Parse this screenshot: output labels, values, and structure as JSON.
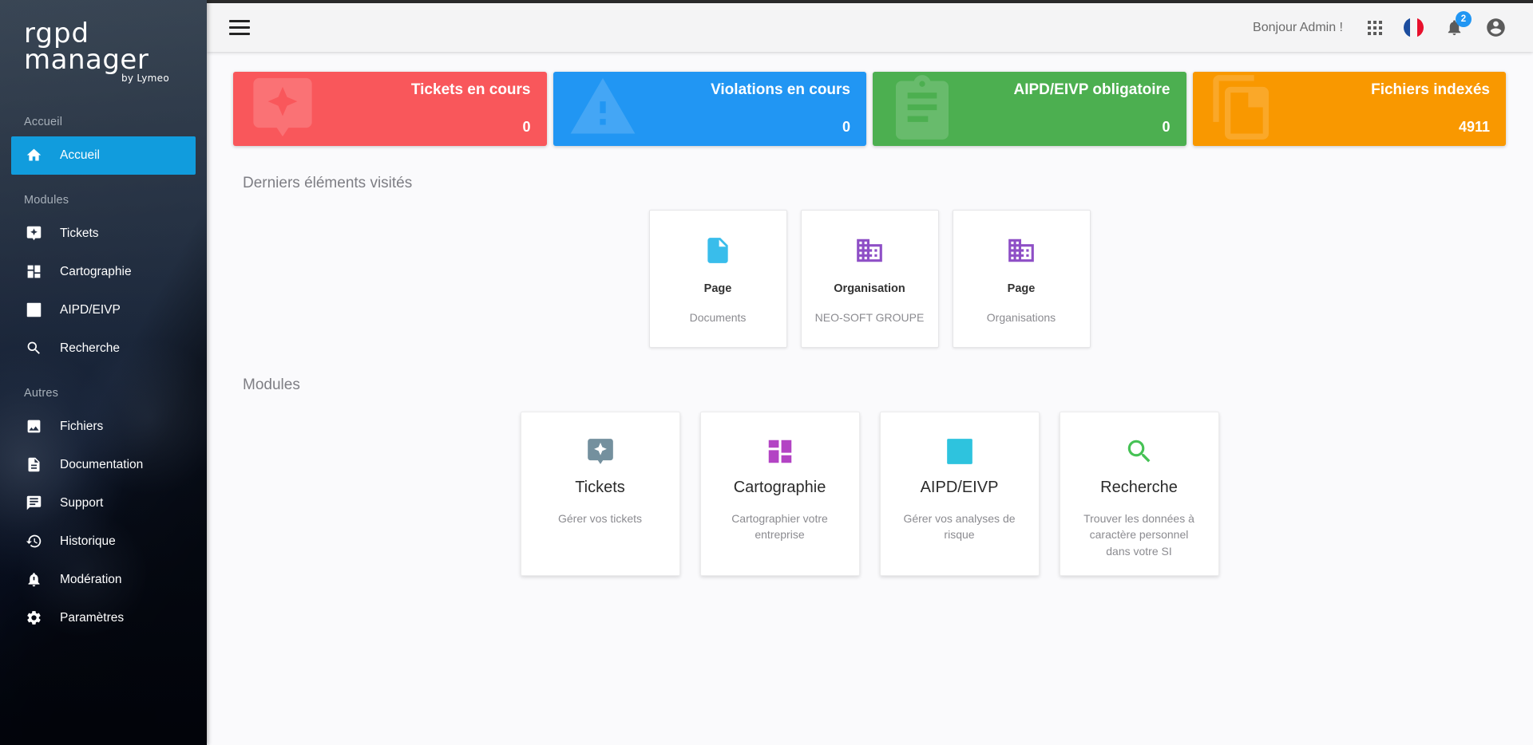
{
  "brand": {
    "line1": "rgpd",
    "line2": "manager",
    "sub": "by Lymeo"
  },
  "sidebar": {
    "sections": [
      {
        "title": "Accueil",
        "items": [
          {
            "label": "Accueil",
            "icon": "home-icon",
            "active": true
          }
        ]
      },
      {
        "title": "Modules",
        "items": [
          {
            "label": "Tickets",
            "icon": "ticket-icon",
            "active": false
          },
          {
            "label": "Cartographie",
            "icon": "dashboard-icon",
            "active": false
          },
          {
            "label": "AIPD/EIVP",
            "icon": "bar-chart-icon",
            "active": false
          },
          {
            "label": "Recherche",
            "icon": "search-icon",
            "active": false
          }
        ]
      },
      {
        "title": "Autres",
        "items": [
          {
            "label": "Fichiers",
            "icon": "image-icon",
            "active": false
          },
          {
            "label": "Documentation",
            "icon": "document-icon",
            "active": false
          },
          {
            "label": "Support",
            "icon": "chat-icon",
            "active": false
          },
          {
            "label": "Historique",
            "icon": "history-icon",
            "active": false
          },
          {
            "label": "Modération",
            "icon": "bell-alert-icon",
            "active": false
          },
          {
            "label": "Paramètres",
            "icon": "gear-icon",
            "active": false
          }
        ]
      }
    ]
  },
  "topbar": {
    "menu_icon": "hamburger-icon",
    "greeting": "Bonjour Admin !",
    "apps_icon": "apps-grid-icon",
    "language_icon": "french-flag-icon",
    "notifications_icon": "bell-icon",
    "notifications_count": "2",
    "account_icon": "account-circle-icon"
  },
  "stats": [
    {
      "title": "Tickets en cours",
      "value": "0",
      "color": "#f9575b",
      "icon": "ticket-icon"
    },
    {
      "title": "Violations en cours",
      "value": "0",
      "color": "#2196f3",
      "icon": "warning-triangle-icon"
    },
    {
      "title": "AIPD/EIVP obligatoire",
      "value": "0",
      "color": "#4caf50",
      "icon": "clipboard-icon"
    },
    {
      "title": "Fichiers indexés",
      "value": "4911",
      "color": "#f99800",
      "icon": "file-copy-icon"
    }
  ],
  "recent": {
    "heading": "Derniers éléments visités",
    "items": [
      {
        "title": "Page",
        "subtitle": "Documents",
        "icon": "page-icon",
        "color": "#39bdeb"
      },
      {
        "title": "Organisation",
        "subtitle": "NEO-SOFT GROUPE",
        "icon": "organisation-icon",
        "color": "#8e4fc6"
      },
      {
        "title": "Page",
        "subtitle": "Organisations",
        "icon": "organisation-icon",
        "color": "#8e4fc6"
      }
    ]
  },
  "modules": {
    "heading": "Modules",
    "items": [
      {
        "title": "Tickets",
        "subtitle": "Gérer vos tickets",
        "icon": "ticket-icon",
        "color": "#74909e"
      },
      {
        "title": "Cartographie",
        "subtitle": "Cartographier votre entreprise",
        "icon": "dashboard-icon",
        "color": "#b344c4"
      },
      {
        "title": "AIPD/EIVP",
        "subtitle": "Gérer vos analyses de risque",
        "icon": "bar-chart-icon",
        "color": "#2ec3de"
      },
      {
        "title": "Recherche",
        "subtitle": "Trouver les données à caractère personnel dans votre SI",
        "icon": "search-icon",
        "color": "#46c255"
      }
    ]
  }
}
